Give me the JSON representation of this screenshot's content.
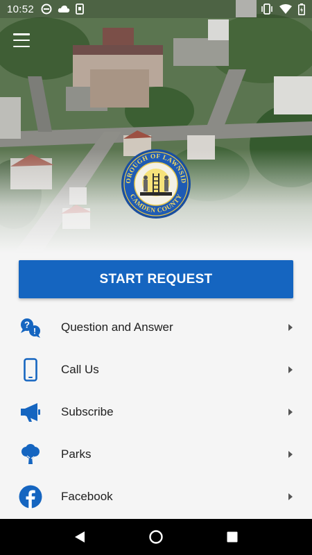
{
  "status_bar": {
    "time": "10:52",
    "left_icons": [
      "no-disturb-icon",
      "cloud-icon",
      "phone-vibrate-icon"
    ],
    "right_icons": [
      "vibrate-icon",
      "wifi-icon",
      "battery-icon"
    ]
  },
  "header": {
    "menu_icon": "hamburger-menu-icon",
    "seal": {
      "top_text": "BOROUGH OF LAWNSIDE",
      "bottom_text": "CAMDEN COUNTY"
    }
  },
  "start_request": {
    "label": "START REQUEST",
    "color": "#1565c0"
  },
  "menu": {
    "items": [
      {
        "label": "Question and Answer",
        "icon": "question-answer-icon"
      },
      {
        "label": "Call Us",
        "icon": "mobile-phone-icon"
      },
      {
        "label": "Subscribe",
        "icon": "megaphone-icon"
      },
      {
        "label": "Parks",
        "icon": "tree-icon"
      },
      {
        "label": "Facebook",
        "icon": "facebook-icon"
      }
    ]
  },
  "nav_bar": {
    "icons": [
      "back-icon",
      "home-icon",
      "recents-icon"
    ]
  },
  "colors": {
    "accent": "#1565c0",
    "icon": "#1565c0",
    "background": "#f5f5f5"
  }
}
